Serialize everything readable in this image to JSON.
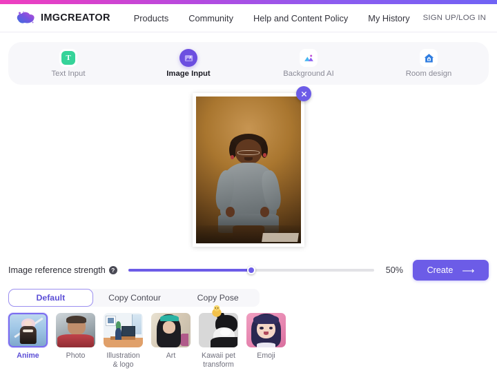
{
  "brand": {
    "name": "IMGCREATOR",
    "logo_icon": "blob-logo-icon"
  },
  "header": {
    "nav": [
      {
        "label": "Products"
      },
      {
        "label": "Community"
      },
      {
        "label": "Help and Content Policy"
      },
      {
        "label": "My History"
      }
    ],
    "auth_label": "SIGN UP/LOG IN"
  },
  "modes": [
    {
      "label": "Text Input",
      "icon": "text-input-icon",
      "icon_glyph": "T",
      "active": false
    },
    {
      "label": "Image Input",
      "icon": "image-input-icon",
      "active": true
    },
    {
      "label": "Background AI",
      "icon": "background-ai-icon",
      "active": false
    },
    {
      "label": "Room design",
      "icon": "room-design-icon",
      "active": false
    }
  ],
  "preview": {
    "image_alt": "uploaded portrait photo of a young girl in a grey dress",
    "close_label": "×",
    "watermark": ""
  },
  "strength": {
    "label": "Image reference strength",
    "help_glyph": "?",
    "value_label": "50%",
    "value": 50
  },
  "create": {
    "label": "Create",
    "arrow_glyph": "⟶"
  },
  "style_tabs": [
    {
      "label": "Default",
      "active": true
    },
    {
      "label": "Copy Contour",
      "active": false
    },
    {
      "label": "Copy Pose",
      "active": false
    }
  ],
  "style_thumbs": [
    {
      "label": "Anime",
      "art": "t-anime",
      "selected": true
    },
    {
      "label": "Photo",
      "art": "t-photo",
      "selected": false
    },
    {
      "label": "Illustration & logo",
      "art": "t-illus",
      "selected": false
    },
    {
      "label": "Art",
      "art": "t-art",
      "selected": false
    },
    {
      "label": "Kawaii pet transform",
      "art": "t-pet",
      "selected": false
    },
    {
      "label": "Emoji",
      "art": "t-emoji",
      "selected": false
    }
  ],
  "colors": {
    "accent": "#6c5ce7",
    "accent_light": "#9b8ef0",
    "green": "#36d399",
    "blue": "#3b82f6",
    "strip_left": "#ef3fbf",
    "strip_right": "#6f63f5"
  }
}
